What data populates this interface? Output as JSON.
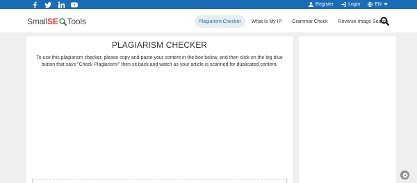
{
  "topbar": {
    "social": [
      "facebook-icon",
      "twitter-icon",
      "linkedin-icon",
      "youtube-icon"
    ],
    "register": "Register",
    "login": "Login",
    "language": "EN",
    "color": "#1b6cb6"
  },
  "header": {
    "logo": {
      "part1": "Small",
      "part2": "SE",
      "part3": "Tools"
    },
    "nav": [
      {
        "label": "Plagiarism Checker",
        "active": true
      },
      {
        "label": "What Is My IP",
        "active": false
      },
      {
        "label": "Grammar Check",
        "active": false
      },
      {
        "label": "Reverse Image Search",
        "active": false
      }
    ]
  },
  "main": {
    "title": "PLAGIARISM CHECKER",
    "description": "To use this plagiarism checker, please copy and paste your content in the box below, and then click on the big blue button that says \"Check Plagiarism!\" then sit back and watch as your article is scanned for duplicated content."
  }
}
